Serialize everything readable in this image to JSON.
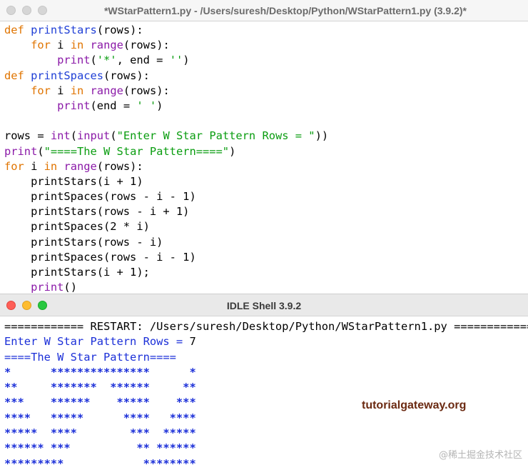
{
  "editor": {
    "title": "*WStarPattern1.py - /Users/suresh/Desktop/Python/WStarPattern1.py (3.9.2)*",
    "code_lines": [
      [
        {
          "t": "def ",
          "c": "kw"
        },
        {
          "t": "printStars",
          "c": "fn"
        },
        {
          "t": "(rows):",
          "c": ""
        }
      ],
      [
        {
          "t": "    ",
          "c": ""
        },
        {
          "t": "for",
          "c": "kw"
        },
        {
          "t": " i ",
          "c": ""
        },
        {
          "t": "in",
          "c": "kw"
        },
        {
          "t": " ",
          "c": ""
        },
        {
          "t": "range",
          "c": "bi"
        },
        {
          "t": "(rows):",
          "c": ""
        }
      ],
      [
        {
          "t": "        ",
          "c": ""
        },
        {
          "t": "print",
          "c": "bi"
        },
        {
          "t": "(",
          "c": ""
        },
        {
          "t": "'*'",
          "c": "str"
        },
        {
          "t": ", end = ",
          "c": ""
        },
        {
          "t": "''",
          "c": "str"
        },
        {
          "t": ")",
          "c": ""
        }
      ],
      [
        {
          "t": "def ",
          "c": "kw"
        },
        {
          "t": "printSpaces",
          "c": "fn"
        },
        {
          "t": "(rows):",
          "c": ""
        }
      ],
      [
        {
          "t": "    ",
          "c": ""
        },
        {
          "t": "for",
          "c": "kw"
        },
        {
          "t": " i ",
          "c": ""
        },
        {
          "t": "in",
          "c": "kw"
        },
        {
          "t": " ",
          "c": ""
        },
        {
          "t": "range",
          "c": "bi"
        },
        {
          "t": "(rows):",
          "c": ""
        }
      ],
      [
        {
          "t": "        ",
          "c": ""
        },
        {
          "t": "print",
          "c": "bi"
        },
        {
          "t": "(end = ",
          "c": ""
        },
        {
          "t": "' '",
          "c": "str"
        },
        {
          "t": ")",
          "c": ""
        }
      ],
      [],
      [
        {
          "t": "rows = ",
          "c": ""
        },
        {
          "t": "int",
          "c": "bi"
        },
        {
          "t": "(",
          "c": ""
        },
        {
          "t": "input",
          "c": "bi"
        },
        {
          "t": "(",
          "c": ""
        },
        {
          "t": "\"Enter W Star Pattern Rows = \"",
          "c": "str"
        },
        {
          "t": "))",
          "c": ""
        }
      ],
      [
        {
          "t": "print",
          "c": "bi"
        },
        {
          "t": "(",
          "c": ""
        },
        {
          "t": "\"====The W Star Pattern====\"",
          "c": "str"
        },
        {
          "t": ")",
          "c": ""
        }
      ],
      [
        {
          "t": "for",
          "c": "kw"
        },
        {
          "t": " i ",
          "c": ""
        },
        {
          "t": "in",
          "c": "kw"
        },
        {
          "t": " ",
          "c": ""
        },
        {
          "t": "range",
          "c": "bi"
        },
        {
          "t": "(rows):",
          "c": ""
        }
      ],
      [
        {
          "t": "    printStars(i + 1)",
          "c": ""
        }
      ],
      [
        {
          "t": "    printSpaces(rows - i - 1)",
          "c": ""
        }
      ],
      [
        {
          "t": "    printStars(rows - i + 1)",
          "c": ""
        }
      ],
      [
        {
          "t": "    printSpaces(2 * i)",
          "c": ""
        }
      ],
      [
        {
          "t": "    printStars(rows - i)",
          "c": ""
        }
      ],
      [
        {
          "t": "    printSpaces(rows - i - 1)",
          "c": ""
        }
      ],
      [
        {
          "t": "    printStars(i + 1);",
          "c": ""
        }
      ],
      [
        {
          "t": "    ",
          "c": ""
        },
        {
          "t": "print",
          "c": "bi"
        },
        {
          "t": "()",
          "c": ""
        }
      ]
    ]
  },
  "shell": {
    "title": "IDLE Shell 3.9.2",
    "restart_line": "============ RESTART: /Users/suresh/Desktop/Python/WStarPattern1.py ============",
    "prompt_line": "Enter W Star Pattern Rows = ",
    "input_value": "7",
    "header_line": "====The W Star Pattern====",
    "pattern_lines": [
      "*      ***************      *",
      "**     *******  ******     **",
      "***    ******    *****    ***",
      "****   *****      ****   ****",
      "*****  ****        ***  *****",
      "****** ***          ** ******",
      "*********            ********"
    ]
  },
  "brand_text": "tutorialgateway.org",
  "watermark_text": "@稀土掘金技术社区"
}
